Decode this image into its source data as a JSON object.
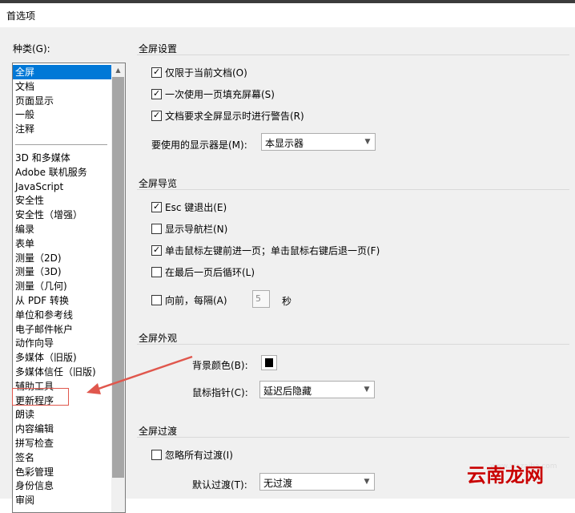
{
  "window": {
    "title": "首选项"
  },
  "categories": {
    "label": "种类(G):",
    "top_items": [
      "全屏",
      "文档",
      "页面显示",
      "一般",
      "注释"
    ],
    "items": [
      "3D 和多媒体",
      "Adobe 联机服务",
      "JavaScript",
      "安全性",
      "安全性（增强）",
      "编录",
      "表单",
      "测量（2D)",
      "测量（3D)",
      "测量（几何)",
      "从 PDF 转换",
      "单位和参考线",
      "电子邮件帐户",
      "动作向导",
      "多媒体（旧版)",
      "多媒体信任（旧版)",
      "辅助工具",
      "更新程序",
      "朗读",
      "内容编辑",
      "拼写检查",
      "签名",
      "色彩管理",
      "身份信息",
      "审阅"
    ],
    "selected": "全屏",
    "highlighted": "更新程序"
  },
  "fullscreen_setup": {
    "title": "全屏设置",
    "options": [
      {
        "label": "仅限于当前文档(O)",
        "checked": true
      },
      {
        "label": "一次使用一页填充屏幕(S)",
        "checked": true
      },
      {
        "label": "文档要求全屏显示时进行警告(R)",
        "checked": true
      }
    ],
    "monitor_label": "要使用的显示器是(M):",
    "monitor_value": "本显示器"
  },
  "fullscreen_nav": {
    "title": "全屏导览",
    "options": [
      {
        "label": "Esc 键退出(E)",
        "checked": true
      },
      {
        "label": "显示导航栏(N)",
        "checked": false
      },
      {
        "label": "单击鼠标左键前进一页；单击鼠标右键后退一页(F)",
        "checked": true
      },
      {
        "label": "在最后一页后循环(L)",
        "checked": false
      },
      {
        "label": "向前，每隔(A)",
        "checked": false
      }
    ],
    "interval_value": "5",
    "interval_unit": "秒"
  },
  "fullscreen_appearance": {
    "title": "全屏外观",
    "bg_color_label": "背景颜色(B):",
    "bg_color": "#000000",
    "cursor_label": "鼠标指针(C):",
    "cursor_value": "延迟后隐藏"
  },
  "fullscreen_transition": {
    "title": "全屏过渡",
    "ignore_label": "忽略所有过渡(I)",
    "ignore_checked": false,
    "default_label": "默认过渡(T):",
    "default_value": "无过渡"
  },
  "watermark": {
    "logo_text": "云南龙网",
    "url": "www.xiazaiba.com"
  },
  "colors": {
    "selection": "#0078d7",
    "annotation": "#e0574d"
  }
}
